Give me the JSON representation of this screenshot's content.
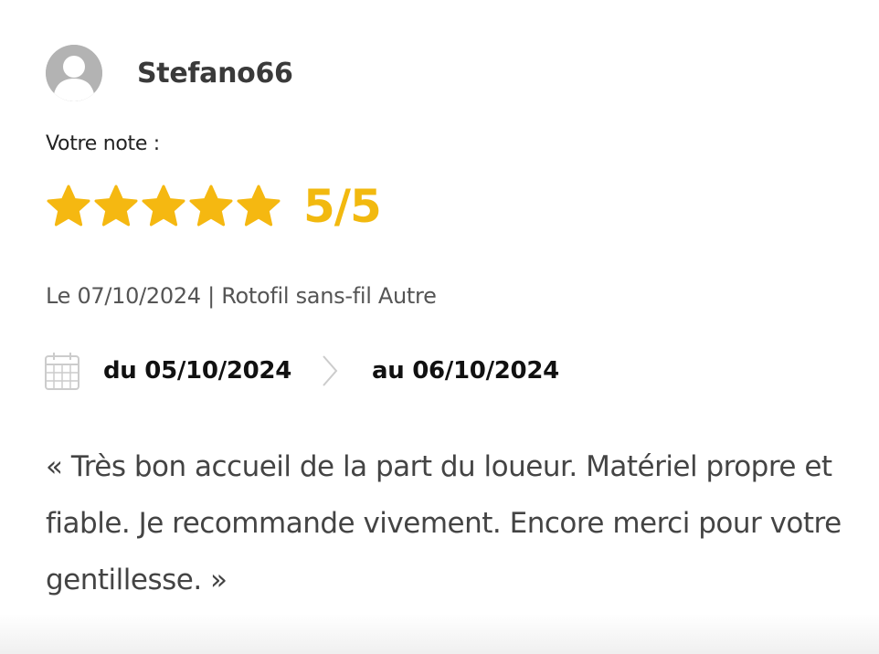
{
  "review": {
    "username": "Stefano66",
    "note_label": "Votre note :",
    "rating": 5,
    "rating_max": 5,
    "score_text": "5/5",
    "meta": "Le 07/10/2024 | Rotofil sans-fil Autre",
    "date_from": "du 05/10/2024",
    "date_to": "au 06/10/2024",
    "comment": "« Très bon accueil de la part du loueur. Matériel propre et fiable. Je recommande vivement. Encore merci pour votre gentillesse. »"
  },
  "icons": {
    "avatar": "user-silhouette-icon",
    "star": "star-icon",
    "calendar": "calendar-icon",
    "arrow": "chevron-right-icon"
  },
  "colors": {
    "star": "#f5b811",
    "score": "#f2b90f",
    "avatar_bg": "#b3b3b3",
    "text": "#333333"
  }
}
